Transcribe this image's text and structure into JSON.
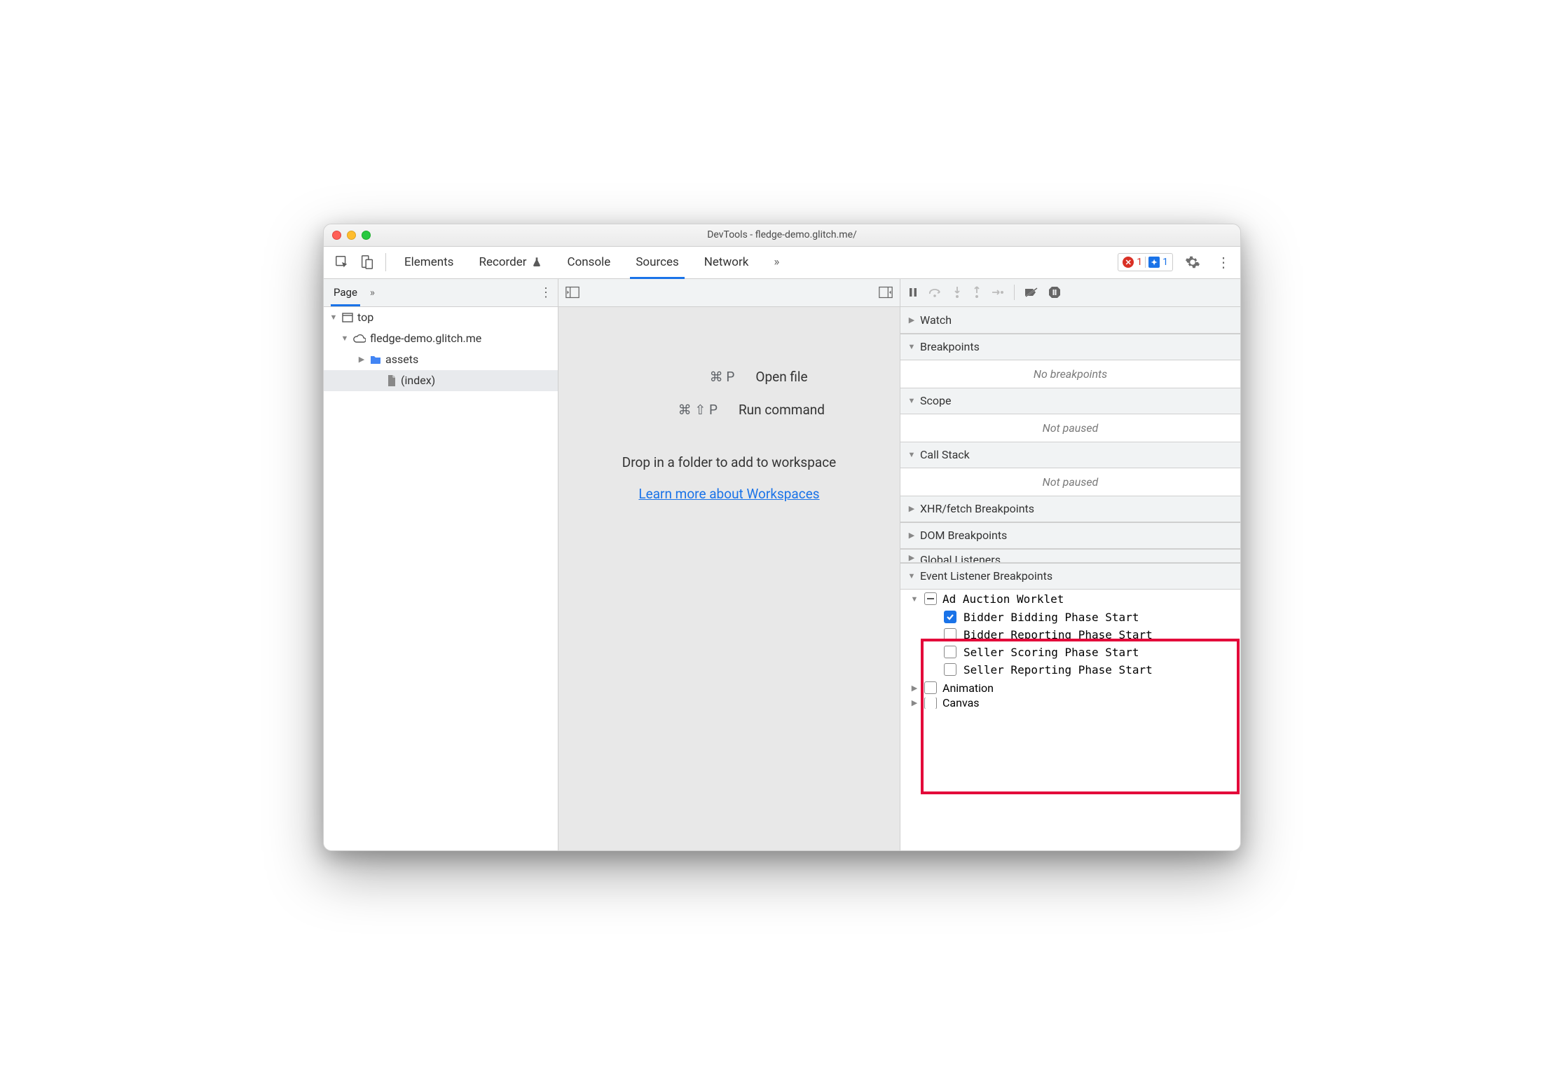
{
  "title": "DevTools - fledge-demo.glitch.me/",
  "tabs": {
    "elements": "Elements",
    "recorder": "Recorder",
    "console": "Console",
    "sources": "Sources",
    "network": "Network"
  },
  "badges": {
    "errors": "1",
    "info": "1"
  },
  "subnav": {
    "page": "Page"
  },
  "tree": {
    "top": "top",
    "domain": "fledge-demo.glitch.me",
    "assets": "assets",
    "index": "(index)"
  },
  "editor": {
    "open_keys": "⌘ P",
    "open_label": "Open file",
    "run_keys": "⌘ ⇧ P",
    "run_label": "Run command",
    "drop": "Drop in a folder to add to workspace",
    "link": "Learn more about Workspaces"
  },
  "panels": {
    "watch": "Watch",
    "breakpoints": "Breakpoints",
    "no_bp": "No breakpoints",
    "scope": "Scope",
    "not_paused1": "Not paused",
    "callstack": "Call Stack",
    "not_paused2": "Not paused",
    "xhr": "XHR/fetch Breakpoints",
    "dom": "DOM Breakpoints",
    "global": "Global Listeners",
    "elb": "Event Listener Breakpoints",
    "worklet": "Ad Auction Worklet",
    "opt1": "Bidder Bidding Phase Start",
    "opt2": "Bidder Reporting Phase Start",
    "opt3": "Seller Scoring Phase Start",
    "opt4": "Seller Reporting Phase Start",
    "animation": "Animation",
    "canvas": "Canvas"
  }
}
